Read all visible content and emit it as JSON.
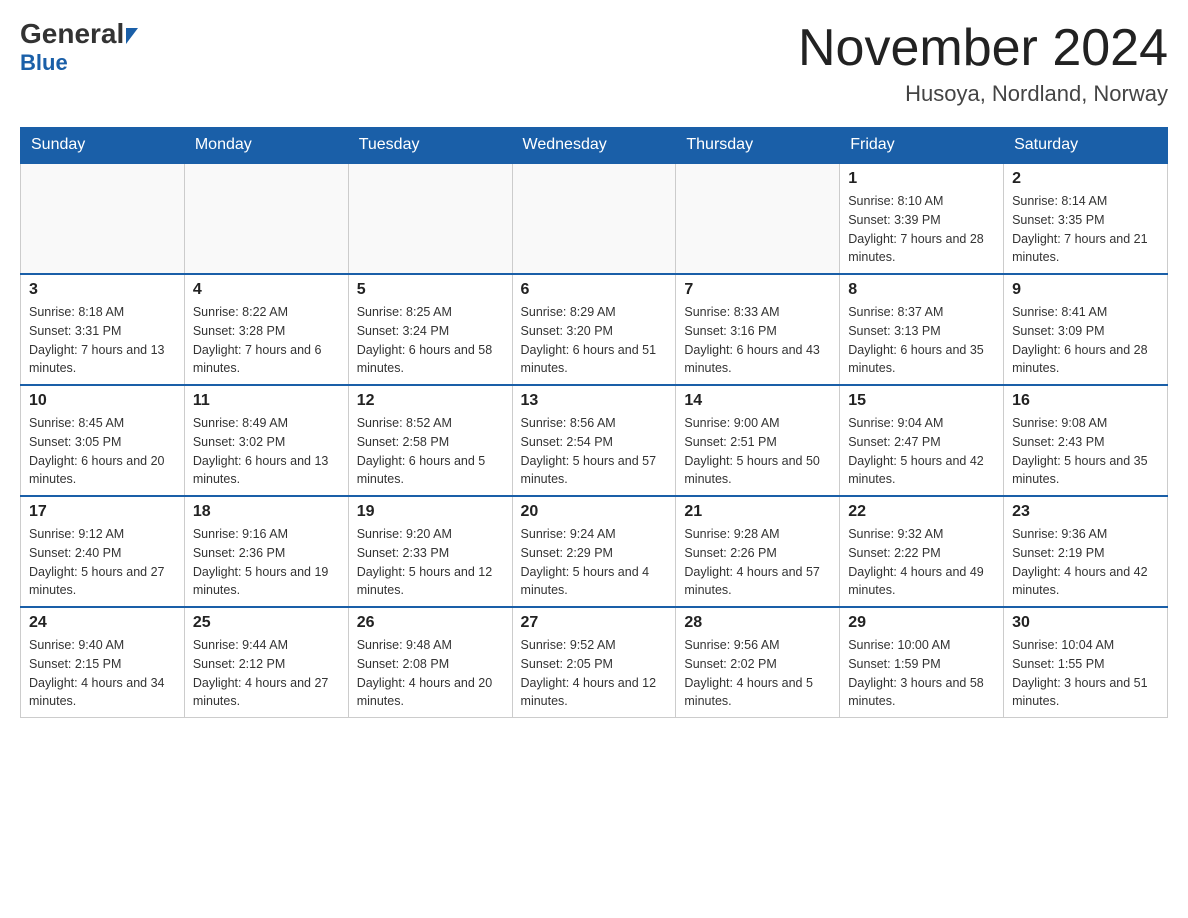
{
  "header": {
    "logo_general": "General",
    "logo_blue": "Blue",
    "title": "November 2024",
    "subtitle": "Husoya, Nordland, Norway"
  },
  "days_of_week": [
    "Sunday",
    "Monday",
    "Tuesday",
    "Wednesday",
    "Thursday",
    "Friday",
    "Saturday"
  ],
  "weeks": [
    {
      "days": [
        {
          "number": "",
          "info": ""
        },
        {
          "number": "",
          "info": ""
        },
        {
          "number": "",
          "info": ""
        },
        {
          "number": "",
          "info": ""
        },
        {
          "number": "",
          "info": ""
        },
        {
          "number": "1",
          "info": "Sunrise: 8:10 AM\nSunset: 3:39 PM\nDaylight: 7 hours and 28 minutes."
        },
        {
          "number": "2",
          "info": "Sunrise: 8:14 AM\nSunset: 3:35 PM\nDaylight: 7 hours and 21 minutes."
        }
      ]
    },
    {
      "days": [
        {
          "number": "3",
          "info": "Sunrise: 8:18 AM\nSunset: 3:31 PM\nDaylight: 7 hours and 13 minutes."
        },
        {
          "number": "4",
          "info": "Sunrise: 8:22 AM\nSunset: 3:28 PM\nDaylight: 7 hours and 6 minutes."
        },
        {
          "number": "5",
          "info": "Sunrise: 8:25 AM\nSunset: 3:24 PM\nDaylight: 6 hours and 58 minutes."
        },
        {
          "number": "6",
          "info": "Sunrise: 8:29 AM\nSunset: 3:20 PM\nDaylight: 6 hours and 51 minutes."
        },
        {
          "number": "7",
          "info": "Sunrise: 8:33 AM\nSunset: 3:16 PM\nDaylight: 6 hours and 43 minutes."
        },
        {
          "number": "8",
          "info": "Sunrise: 8:37 AM\nSunset: 3:13 PM\nDaylight: 6 hours and 35 minutes."
        },
        {
          "number": "9",
          "info": "Sunrise: 8:41 AM\nSunset: 3:09 PM\nDaylight: 6 hours and 28 minutes."
        }
      ]
    },
    {
      "days": [
        {
          "number": "10",
          "info": "Sunrise: 8:45 AM\nSunset: 3:05 PM\nDaylight: 6 hours and 20 minutes."
        },
        {
          "number": "11",
          "info": "Sunrise: 8:49 AM\nSunset: 3:02 PM\nDaylight: 6 hours and 13 minutes."
        },
        {
          "number": "12",
          "info": "Sunrise: 8:52 AM\nSunset: 2:58 PM\nDaylight: 6 hours and 5 minutes."
        },
        {
          "number": "13",
          "info": "Sunrise: 8:56 AM\nSunset: 2:54 PM\nDaylight: 5 hours and 57 minutes."
        },
        {
          "number": "14",
          "info": "Sunrise: 9:00 AM\nSunset: 2:51 PM\nDaylight: 5 hours and 50 minutes."
        },
        {
          "number": "15",
          "info": "Sunrise: 9:04 AM\nSunset: 2:47 PM\nDaylight: 5 hours and 42 minutes."
        },
        {
          "number": "16",
          "info": "Sunrise: 9:08 AM\nSunset: 2:43 PM\nDaylight: 5 hours and 35 minutes."
        }
      ]
    },
    {
      "days": [
        {
          "number": "17",
          "info": "Sunrise: 9:12 AM\nSunset: 2:40 PM\nDaylight: 5 hours and 27 minutes."
        },
        {
          "number": "18",
          "info": "Sunrise: 9:16 AM\nSunset: 2:36 PM\nDaylight: 5 hours and 19 minutes."
        },
        {
          "number": "19",
          "info": "Sunrise: 9:20 AM\nSunset: 2:33 PM\nDaylight: 5 hours and 12 minutes."
        },
        {
          "number": "20",
          "info": "Sunrise: 9:24 AM\nSunset: 2:29 PM\nDaylight: 5 hours and 4 minutes."
        },
        {
          "number": "21",
          "info": "Sunrise: 9:28 AM\nSunset: 2:26 PM\nDaylight: 4 hours and 57 minutes."
        },
        {
          "number": "22",
          "info": "Sunrise: 9:32 AM\nSunset: 2:22 PM\nDaylight: 4 hours and 49 minutes."
        },
        {
          "number": "23",
          "info": "Sunrise: 9:36 AM\nSunset: 2:19 PM\nDaylight: 4 hours and 42 minutes."
        }
      ]
    },
    {
      "days": [
        {
          "number": "24",
          "info": "Sunrise: 9:40 AM\nSunset: 2:15 PM\nDaylight: 4 hours and 34 minutes."
        },
        {
          "number": "25",
          "info": "Sunrise: 9:44 AM\nSunset: 2:12 PM\nDaylight: 4 hours and 27 minutes."
        },
        {
          "number": "26",
          "info": "Sunrise: 9:48 AM\nSunset: 2:08 PM\nDaylight: 4 hours and 20 minutes."
        },
        {
          "number": "27",
          "info": "Sunrise: 9:52 AM\nSunset: 2:05 PM\nDaylight: 4 hours and 12 minutes."
        },
        {
          "number": "28",
          "info": "Sunrise: 9:56 AM\nSunset: 2:02 PM\nDaylight: 4 hours and 5 minutes."
        },
        {
          "number": "29",
          "info": "Sunrise: 10:00 AM\nSunset: 1:59 PM\nDaylight: 3 hours and 58 minutes."
        },
        {
          "number": "30",
          "info": "Sunrise: 10:04 AM\nSunset: 1:55 PM\nDaylight: 3 hours and 51 minutes."
        }
      ]
    }
  ]
}
